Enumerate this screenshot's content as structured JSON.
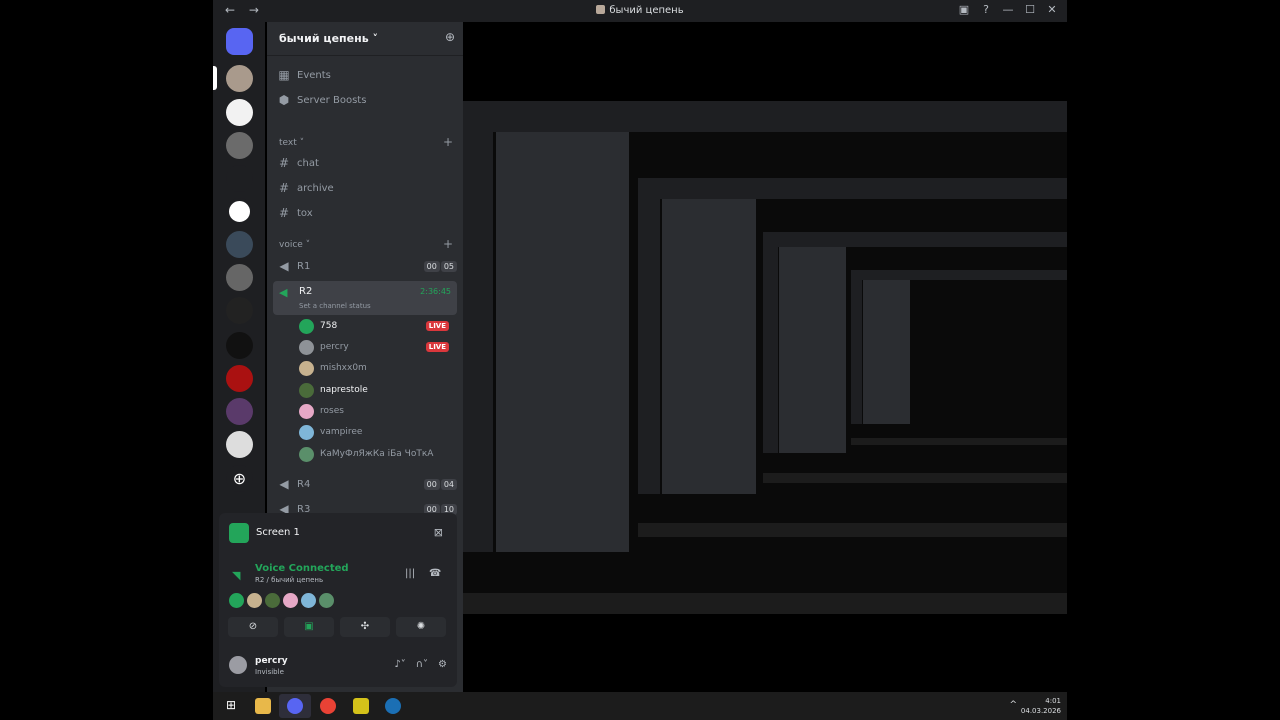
{
  "window": {
    "title": "бычий цепень",
    "back": "←",
    "forward": "→",
    "ctrl_min": "—",
    "ctrl_max": "☐",
    "ctrl_close": "✕"
  },
  "server": {
    "name": "бычий цепень ˅",
    "invite_icon": "person-add-icon"
  },
  "top_items": [
    {
      "label": "Events",
      "icon": "calendar-icon"
    },
    {
      "label": "Server Boosts",
      "icon": "boost-icon"
    }
  ],
  "text_category": "text ˅",
  "text_channels": [
    "chat",
    "archive",
    "tox"
  ],
  "voice_category": "voice ˅",
  "voice_channels": [
    {
      "name": "R1",
      "count": [
        "00",
        "05"
      ]
    },
    {
      "name": "R2",
      "timer": "2:36:45",
      "status": "Set a channel status"
    },
    {
      "name": "R4",
      "count": [
        "00",
        "04"
      ]
    },
    {
      "name": "R3",
      "count": [
        "00",
        "10"
      ]
    }
  ],
  "r2_users": [
    {
      "name": "758",
      "live": "LIVE",
      "color": "#23a55a"
    },
    {
      "name": "percry",
      "live": "LIVE",
      "color": "#8e9297"
    },
    {
      "name": "mishxx0m",
      "color": "#c7b28f"
    },
    {
      "name": "naprestole",
      "color": "#4a6b3a"
    },
    {
      "name": "roses",
      "color": "#e6a8c6"
    },
    {
      "name": "vampiree",
      "color": "#7fb6d8"
    },
    {
      "name": "КаМуФлЯжКа іБа ЧоТкА",
      "color": "#5a8f6a"
    }
  ],
  "panel": {
    "screen_label": "Screen 1",
    "voice_status": "Voice Connected",
    "voice_sub": "R2 / бычий цепень",
    "user_name": "percry",
    "user_status": "Invisible"
  },
  "colors": {
    "accent_green": "#23a55a",
    "live_red": "#da373c",
    "bg_dark": "#1e1f22",
    "panel_bg": "#2b2d31"
  },
  "taskbar": {
    "time": "4:01",
    "date": "04.03.2026",
    "up": "^"
  }
}
